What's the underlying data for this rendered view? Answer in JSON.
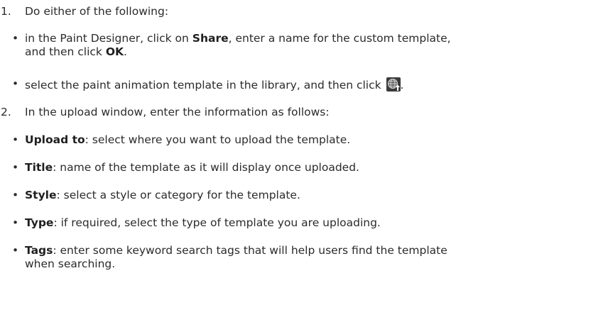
{
  "steps": [
    {
      "number": "1.",
      "text": "Do either of the following:"
    },
    {
      "number": "2.",
      "text": "In the upload window, enter the information as follows:"
    }
  ],
  "step1_bullets": {
    "b1": {
      "pre": "in the Paint Designer, click on ",
      "bold1": "Share",
      "mid": ", enter a name for the custom template,",
      "line2_pre": "and then click ",
      "bold2": "OK",
      "end": "."
    },
    "b2": {
      "pre": "select the paint animation template in the library, and then click ",
      "icon": "globe-upload-icon",
      "end": "."
    }
  },
  "step2_bullets": [
    {
      "term": "Upload to",
      "desc": ": select where you want to upload the template."
    },
    {
      "term": "Title",
      "desc": ": name of the template as it will display once uploaded."
    },
    {
      "term": "Style",
      "desc": ": select a style or category for the template."
    },
    {
      "term": "Type",
      "desc": ": if required, select the type of template you are uploading."
    },
    {
      "term": "Tags",
      "desc": ": enter some keyword search tags that will help users find the template",
      "line2": "when searching."
    }
  ],
  "bullet_char": "•"
}
